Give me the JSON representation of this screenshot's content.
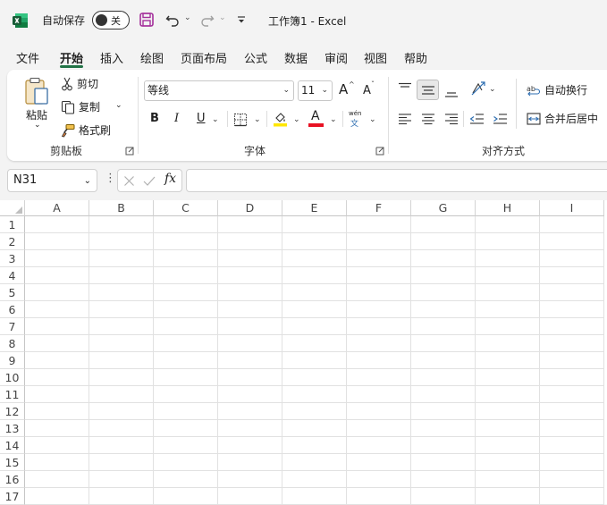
{
  "titlebar": {
    "autosave_label": "自动保存",
    "autosave_state": "关",
    "doc_title": "工作簿1  -  Excel"
  },
  "tabs": [
    {
      "label": "文件",
      "active": false
    },
    {
      "label": "开始",
      "active": true
    },
    {
      "label": "插入",
      "active": false
    },
    {
      "label": "绘图",
      "active": false
    },
    {
      "label": "页面布局",
      "active": false
    },
    {
      "label": "公式",
      "active": false
    },
    {
      "label": "数据",
      "active": false
    },
    {
      "label": "审阅",
      "active": false
    },
    {
      "label": "视图",
      "active": false
    },
    {
      "label": "帮助",
      "active": false
    }
  ],
  "clipboard": {
    "paste": "粘贴",
    "cut": "剪切",
    "copy": "复制",
    "format_painter": "格式刷",
    "group_label": "剪贴板"
  },
  "font": {
    "font_name": "等线",
    "font_size": "11",
    "bold": "B",
    "italic": "I",
    "underline": "U",
    "grow": "A",
    "shrink": "A",
    "font_color_letter": "A",
    "phonetic_top": "wén",
    "phonetic_bottom": "文",
    "group_label": "字体",
    "highlight_color": "#ffe600",
    "font_color": "#e81123"
  },
  "alignment": {
    "wrap_text": "自动换行",
    "merge_center": "合并后居中",
    "group_label": "对齐方式"
  },
  "formula_bar": {
    "name_box": "N31",
    "fx": "fx",
    "formula": ""
  },
  "grid": {
    "columns": [
      "A",
      "B",
      "C",
      "D",
      "E",
      "F",
      "G",
      "H",
      "I"
    ],
    "rows": [
      "1",
      "2",
      "3",
      "4",
      "5",
      "6",
      "7",
      "8",
      "9",
      "10",
      "11",
      "12",
      "13",
      "14",
      "15",
      "16",
      "17"
    ]
  },
  "colors": {
    "accent": "#217346",
    "save_icon": "#a4309b"
  }
}
